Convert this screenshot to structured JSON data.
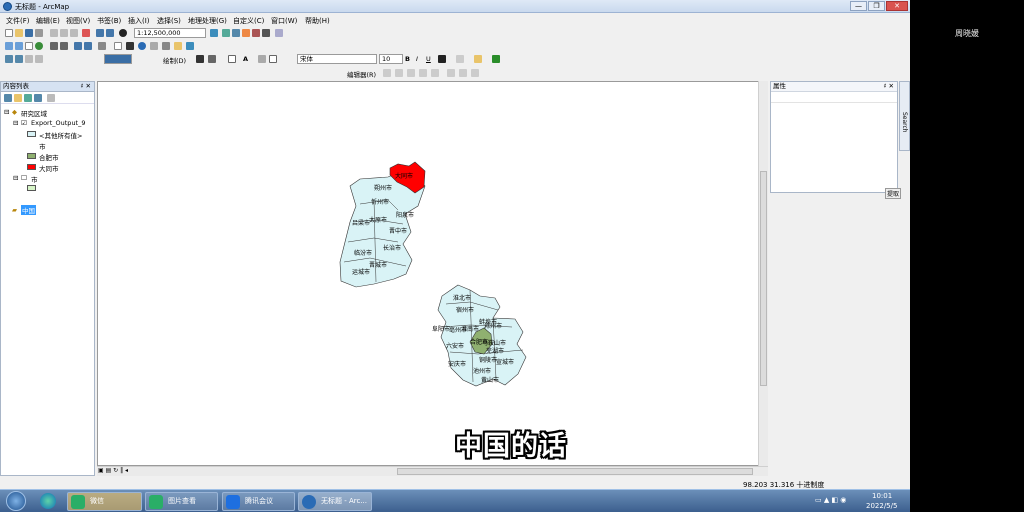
{
  "window": {
    "title": "无标题 - ArcMap",
    "minimize": "—",
    "restore": "❐",
    "close": "✕"
  },
  "menu": [
    "文件(F)",
    "编辑(E)",
    "视图(V)",
    "书签(B)",
    "插入(I)",
    "选择(S)",
    "地理处理(G)",
    "自定义(C)",
    "窗口(W)",
    "帮助(H)"
  ],
  "toolbar": {
    "scale": "1:12,500,000",
    "draw_label": "绘制(D)",
    "font_name": "宋体",
    "font_size": "10",
    "bold": "B",
    "italic": "I",
    "underline": "U",
    "editor_label": "编辑器(R)"
  },
  "toc": {
    "title": "内容列表",
    "pin": "♯ ✕",
    "group": "研究区域",
    "layer1": "Export_Output_9",
    "layer1_sub1": "<其他所有值>",
    "layer1_sub2": "市",
    "legend1": "合肥市",
    "legend2": "大同市",
    "layer2": "市",
    "selected_layer": "中国"
  },
  "map": {
    "shanxi_cities": [
      "大同市",
      "朔州市",
      "忻州市",
      "阳泉市",
      "太原市",
      "吕梁市",
      "晋中市",
      "临汾市",
      "长治市",
      "运城市",
      "晋城市"
    ],
    "anhui_cities": [
      "淮北市",
      "宿州市",
      "亳州市",
      "蚌埠市",
      "阜阳市",
      "淮南市",
      "滁州市",
      "六安市",
      "合肥市",
      "马鞍山市",
      "芜湖市",
      "宣城市",
      "铜陵市",
      "池州市",
      "安庆市",
      "黄山市"
    ],
    "highlight_colors": {
      "datong": "#ff0000",
      "hefei": "#8fb070",
      "base": "#d9f3f6"
    }
  },
  "properties": {
    "title": "属性",
    "pin": "♯ ✕",
    "side_tab": "Search",
    "button": "提取"
  },
  "status": {
    "coords": "98.203  31.316 十进制度"
  },
  "subtitle": "中国的话",
  "taskbar": {
    "items": [
      "微信",
      "图片查看",
      "腾讯会议",
      "无标题 - Arc..."
    ],
    "time": "10:01",
    "date": "2022/5/5"
  },
  "side_panel": {
    "user": "周晓媛"
  }
}
